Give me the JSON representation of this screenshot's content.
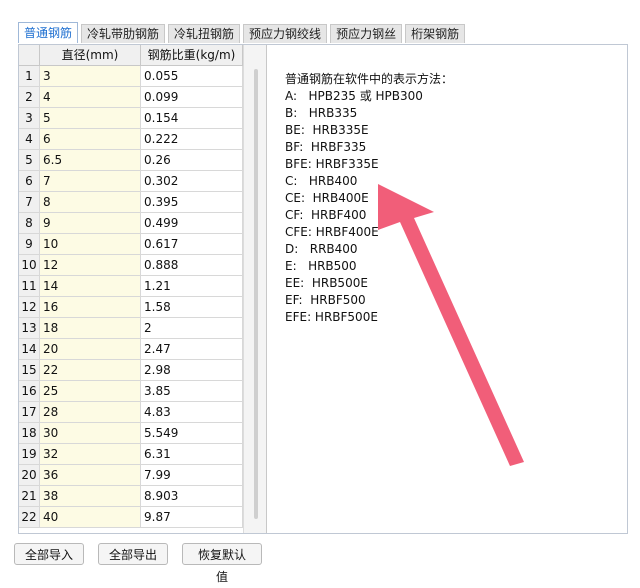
{
  "tabs": [
    "普通钢筋",
    "冷轧带肋钢筋",
    "冷轧扭钢筋",
    "预应力钢绞线",
    "预应力钢丝",
    "桁架钢筋"
  ],
  "table": {
    "headers": [
      "",
      "直径(mm)",
      "钢筋比重(kg/m)"
    ],
    "rows": [
      {
        "index": "1",
        "diameter": "3",
        "weight": "0.055"
      },
      {
        "index": "2",
        "diameter": "4",
        "weight": "0.099"
      },
      {
        "index": "3",
        "diameter": "5",
        "weight": "0.154"
      },
      {
        "index": "4",
        "diameter": "6",
        "weight": "0.222"
      },
      {
        "index": "5",
        "diameter": "6.5",
        "weight": "0.26"
      },
      {
        "index": "6",
        "diameter": "7",
        "weight": "0.302"
      },
      {
        "index": "7",
        "diameter": "8",
        "weight": "0.395"
      },
      {
        "index": "8",
        "diameter": "9",
        "weight": "0.499"
      },
      {
        "index": "9",
        "diameter": "10",
        "weight": "0.617"
      },
      {
        "index": "10",
        "diameter": "12",
        "weight": "0.888"
      },
      {
        "index": "11",
        "diameter": "14",
        "weight": "1.21"
      },
      {
        "index": "12",
        "diameter": "16",
        "weight": "1.58"
      },
      {
        "index": "13",
        "diameter": "18",
        "weight": "2"
      },
      {
        "index": "14",
        "diameter": "20",
        "weight": "2.47"
      },
      {
        "index": "15",
        "diameter": "22",
        "weight": "2.98"
      },
      {
        "index": "16",
        "diameter": "25",
        "weight": "3.85"
      },
      {
        "index": "17",
        "diameter": "28",
        "weight": "4.83"
      },
      {
        "index": "18",
        "diameter": "30",
        "weight": "5.549"
      },
      {
        "index": "19",
        "diameter": "32",
        "weight": "6.31"
      },
      {
        "index": "20",
        "diameter": "36",
        "weight": "7.99"
      },
      {
        "index": "21",
        "diameter": "38",
        "weight": "8.903"
      },
      {
        "index": "22",
        "diameter": "40",
        "weight": "9.87"
      }
    ]
  },
  "description": {
    "title": "普通钢筋在软件中的表示方法：",
    "lines": [
      "A:   HPB235 或 HPB300",
      "B:   HRB335",
      "BE:  HRB335E",
      "BF:  HRBF335",
      "BFE: HRBF335E",
      "C:   HRB400",
      "CE:  HRB400E",
      "CF:  HRBF400",
      "CFE: HRBF400E",
      "D:   RRB400",
      "E:   HRB500",
      "EE:  HRB500E",
      "EF:  HRBF500",
      "EFE: HRBF500E"
    ]
  },
  "buttons": [
    "全部导入",
    "全部导出",
    "恢复默认值"
  ],
  "colors": {
    "active_tab_text": "#1e6fd0",
    "diameter_column_bg": "#fdfbe4",
    "arrow": "#f0506e"
  }
}
